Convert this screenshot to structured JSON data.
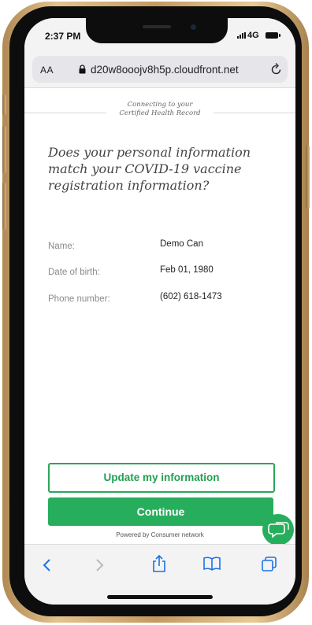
{
  "status_bar": {
    "time": "2:37 PM",
    "network": "4G"
  },
  "browser": {
    "text_size_label": "AA",
    "url": "d20w8ooojv8h5p.cloudfront.net"
  },
  "page": {
    "header_line1": "Connecting to your",
    "header_line2": "Certified Health Record",
    "question": "Does your personal information match your COVID-19 vaccine registration information?",
    "fields": [
      {
        "label": "Name:",
        "value": "Demo Can"
      },
      {
        "label": "Date of birth:",
        "value": "Feb 01, 1980"
      },
      {
        "label": "Phone number:",
        "value": "(602) 618-1473"
      }
    ],
    "update_button": "Update my information",
    "continue_button": "Continue",
    "powered_by": "Powered by Consumer network"
  },
  "colors": {
    "accent": "#27ae5c",
    "outline": "#2aa858",
    "toolbar_icon": "#1a73e8"
  },
  "icons": [
    "lock-icon",
    "reload-icon",
    "chat-icon",
    "back-icon",
    "forward-icon",
    "share-icon",
    "bookmarks-icon",
    "tabs-icon"
  ]
}
